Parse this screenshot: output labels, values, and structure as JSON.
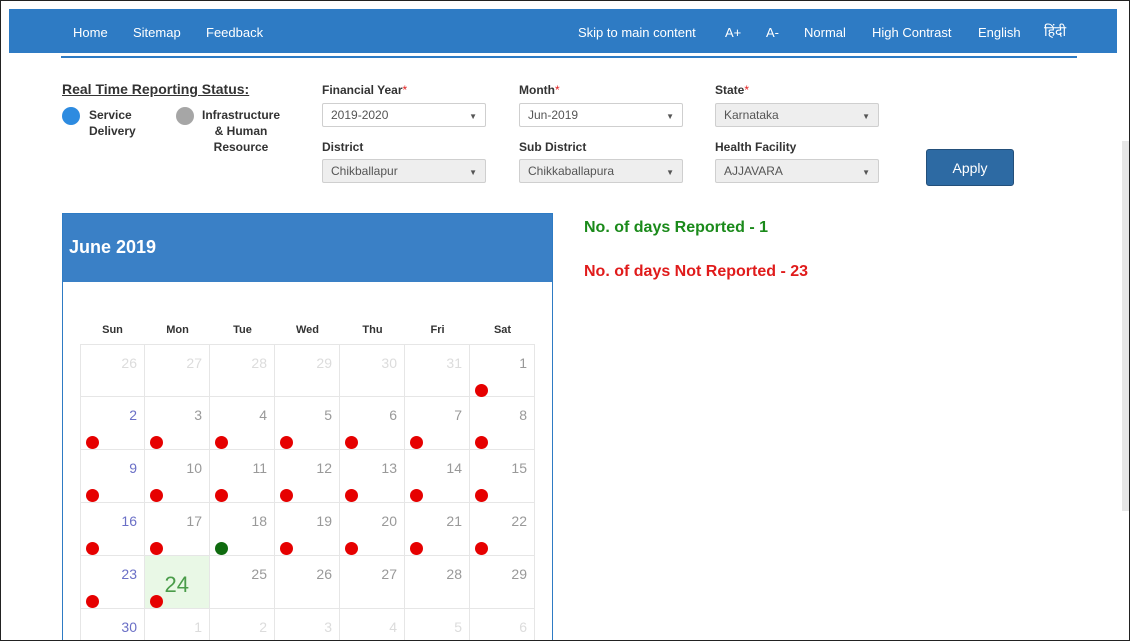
{
  "nav": {
    "left_links": [
      "Home",
      "Sitemap",
      "Feedback"
    ],
    "right_links": [
      "Skip to main content",
      "A+",
      "A-",
      "Normal",
      "High Contrast",
      "English",
      "हिंदी"
    ]
  },
  "status": {
    "title": "Real Time Reporting Status:",
    "options": [
      {
        "label": "Service\nDelivery",
        "color": "#2d8be0"
      },
      {
        "label": "Infrastructure\n& Human\nResource",
        "color": "#a6a6a6"
      }
    ]
  },
  "filters": {
    "financial_year": {
      "label": "Financial Year",
      "value": "2019-2020"
    },
    "month": {
      "label": "Month",
      "value": "Jun-2019"
    },
    "state": {
      "label": "State",
      "value": "Karnataka"
    },
    "district": {
      "label": "District",
      "value": "Chikballapur"
    },
    "sub_district": {
      "label": "Sub District",
      "value": "Chikkaballapura"
    },
    "health_facility": {
      "label": "Health Facility",
      "value": "AJJAVARA"
    },
    "required_mark": "*"
  },
  "apply_label": "Apply",
  "summary": {
    "reported": "No. of days Reported - 1",
    "not_reported": "No. of days Not Reported - 23"
  },
  "colors": {
    "reported": "#0f6b0f",
    "not_reported": "#e60000",
    "header": "#3a80c6"
  },
  "calendar": {
    "title": "June 2019",
    "weekdays": [
      "Sun",
      "Mon",
      "Tue",
      "Wed",
      "Thu",
      "Fri",
      "Sat"
    ],
    "weeks": [
      [
        {
          "d": "26",
          "other": true
        },
        {
          "d": "27",
          "other": true
        },
        {
          "d": "28",
          "other": true
        },
        {
          "d": "29",
          "other": true
        },
        {
          "d": "30",
          "other": true
        },
        {
          "d": "31",
          "other": true
        },
        {
          "d": "1",
          "status": "not_reported"
        }
      ],
      [
        {
          "d": "2",
          "status": "not_reported"
        },
        {
          "d": "3",
          "status": "not_reported"
        },
        {
          "d": "4",
          "status": "not_reported"
        },
        {
          "d": "5",
          "status": "not_reported"
        },
        {
          "d": "6",
          "status": "not_reported"
        },
        {
          "d": "7",
          "status": "not_reported"
        },
        {
          "d": "8",
          "status": "not_reported"
        }
      ],
      [
        {
          "d": "9",
          "status": "not_reported"
        },
        {
          "d": "10",
          "status": "not_reported"
        },
        {
          "d": "11",
          "status": "not_reported"
        },
        {
          "d": "12",
          "status": "not_reported"
        },
        {
          "d": "13",
          "status": "not_reported"
        },
        {
          "d": "14",
          "status": "not_reported"
        },
        {
          "d": "15",
          "status": "not_reported"
        }
      ],
      [
        {
          "d": "16",
          "status": "not_reported"
        },
        {
          "d": "17",
          "status": "not_reported"
        },
        {
          "d": "18",
          "status": "reported"
        },
        {
          "d": "19",
          "status": "not_reported"
        },
        {
          "d": "20",
          "status": "not_reported"
        },
        {
          "d": "21",
          "status": "not_reported"
        },
        {
          "d": "22",
          "status": "not_reported"
        }
      ],
      [
        {
          "d": "23",
          "status": "not_reported"
        },
        {
          "d": "24",
          "status": "not_reported",
          "today": true
        },
        {
          "d": "25"
        },
        {
          "d": "26"
        },
        {
          "d": "27"
        },
        {
          "d": "28"
        },
        {
          "d": "29"
        }
      ],
      [
        {
          "d": "30"
        },
        {
          "d": "1",
          "other": true
        },
        {
          "d": "2",
          "other": true
        },
        {
          "d": "3",
          "other": true
        },
        {
          "d": "4",
          "other": true
        },
        {
          "d": "5",
          "other": true
        },
        {
          "d": "6",
          "other": true
        }
      ]
    ]
  }
}
